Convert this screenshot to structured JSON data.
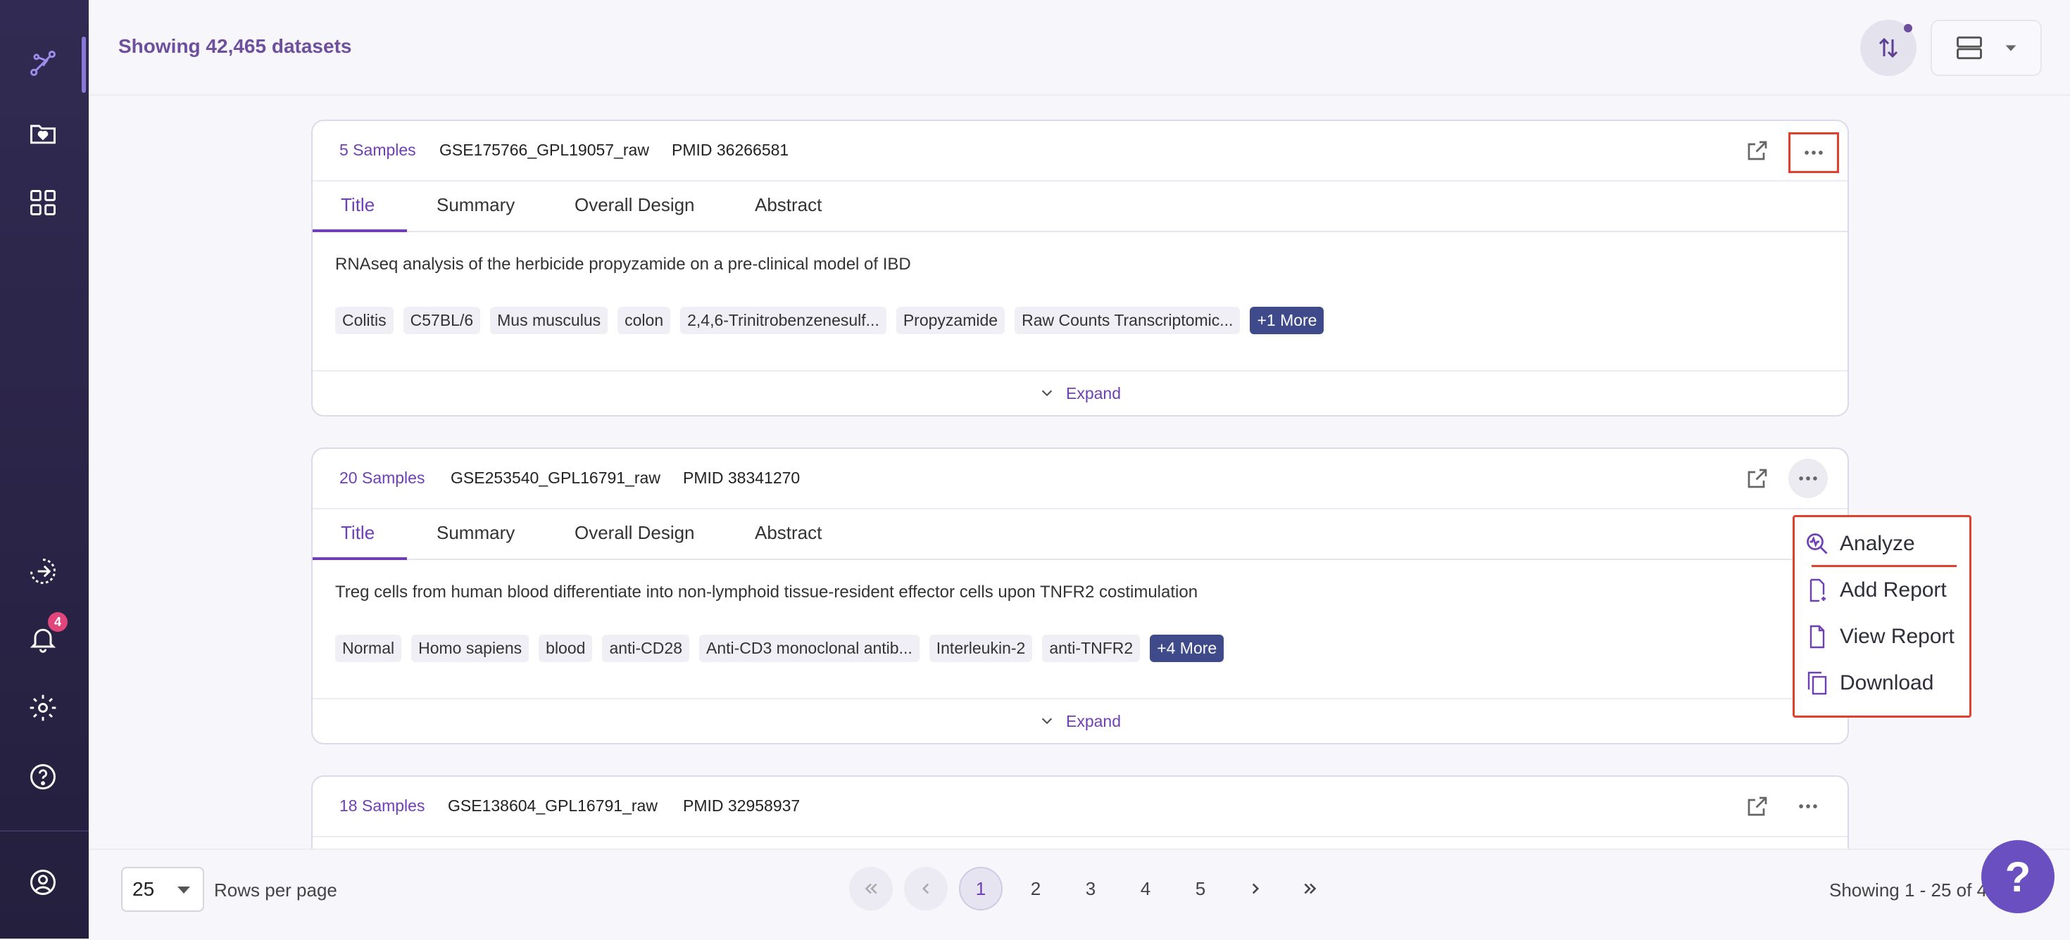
{
  "header": {
    "title": "Showing 42,465 datasets"
  },
  "sidebar": {
    "notification_count": "4"
  },
  "tabs": [
    "Title",
    "Summary",
    "Overall Design",
    "Abstract"
  ],
  "expand_label": "Expand",
  "cards": [
    {
      "samples": "5 Samples",
      "gse": "GSE175766_GPL19057_raw",
      "pmid": "PMID 36266581",
      "title": "RNAseq analysis of the herbicide propyzamide on a pre-clinical model of IBD",
      "tags": [
        "Colitis",
        "C57BL/6",
        "Mus musculus",
        "colon",
        "2,4,6-Trinitrobenzenesulf...",
        "Propyzamide",
        "Raw Counts Transcriptomic..."
      ],
      "more": "+1 More"
    },
    {
      "samples": "20 Samples",
      "gse": "GSE253540_GPL16791_raw",
      "pmid": "PMID 38341270",
      "title": "Treg cells from human blood differentiate into non-lymphoid tissue-resident effector cells upon TNFR2 costimulation",
      "tags": [
        "Normal",
        "Homo sapiens",
        "blood",
        "anti-CD28",
        "Anti-CD3 monoclonal antib...",
        "Interleukin-2",
        "anti-TNFR2"
      ],
      "more": "+4 More"
    },
    {
      "samples": "18 Samples",
      "gse": "GSE138604_GPL16791_raw",
      "pmid": "PMID 32958937"
    }
  ],
  "menu": {
    "items": [
      "Analyze",
      "Add Report",
      "View Report",
      "Download"
    ]
  },
  "footer": {
    "rows_value": "25",
    "rows_label": "Rows per page",
    "pages": [
      "1",
      "2",
      "3",
      "4",
      "5"
    ],
    "showing": "Showing 1 - 25 of 4"
  },
  "help_label": "?"
}
